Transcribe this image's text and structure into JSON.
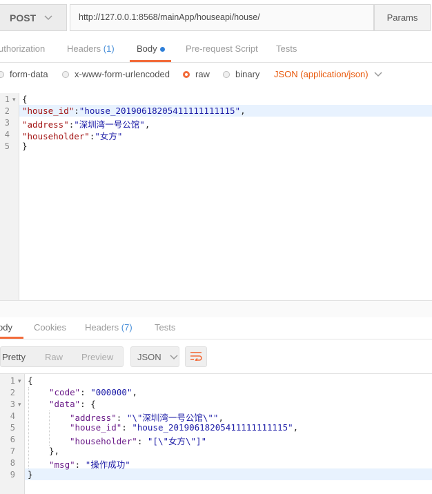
{
  "request": {
    "method": "POST",
    "url": "http://127.0.0.1:8568/mainApp/houseapi/house/",
    "params_label": "Params"
  },
  "request_tabs": [
    {
      "label": "uthorization"
    },
    {
      "label": "Headers",
      "count": "(1)"
    },
    {
      "label": "Body"
    },
    {
      "label": "Pre-request Script"
    },
    {
      "label": "Tests"
    }
  ],
  "body_options": {
    "form_data": "form-data",
    "urlencoded": "x-www-form-urlencoded",
    "raw": "raw",
    "binary": "binary",
    "content_type": "JSON (application/json)"
  },
  "request_body": {
    "line_numbers": [
      "1",
      "2",
      "3",
      "4",
      "5"
    ],
    "l1": "{",
    "l2_key": "\"house_id\"",
    "l2_colon": ":",
    "l2_val": "\"house_20190618205411111111115\"",
    "l2_comma": ",",
    "l3_key": "\"address\"",
    "l3_colon": ":",
    "l3_val": "\"深圳湾一号公馆\"",
    "l3_comma": ",",
    "l4_key": "\"householder\"",
    "l4_colon": ":",
    "l4_val": "\"女方\"",
    "l5": "}"
  },
  "response_tabs": [
    {
      "label": "ody"
    },
    {
      "label": "Cookies"
    },
    {
      "label": "Headers",
      "count": "(7)"
    },
    {
      "label": "Tests"
    }
  ],
  "response_view": {
    "pretty": "Pretty",
    "raw": "Raw",
    "preview": "Preview",
    "format": "JSON"
  },
  "response_body": {
    "line_numbers": [
      "1",
      "2",
      "3",
      "4",
      "5",
      "6",
      "7",
      "8",
      "9"
    ],
    "l1": "{",
    "l2_key": "\"code\"",
    "l2_rest": ": ",
    "l2_val": "\"000000\"",
    "l2_end": ",",
    "l3_key": "\"data\"",
    "l3_rest": ": {",
    "l4_key": "\"address\"",
    "l4_rest": ": ",
    "l4_val": "\"\\\"深圳湾一号公馆\\\"\"",
    "l4_end": ",",
    "l5_key": "\"house_id\"",
    "l5_rest": ": ",
    "l5_val": "\"house_20190618205411111111115\"",
    "l5_end": ",",
    "l6_key": "\"householder\"",
    "l6_rest": ": ",
    "l6_val": "\"[\\\"女方\\\"]\"",
    "l7": "},",
    "l8_key": "\"msg\"",
    "l8_rest": ": ",
    "l8_val": "\"操作成功\"",
    "l9": "}"
  },
  "colors": {
    "accent": "#f26b3a",
    "count_blue": "#4a90d9",
    "content_type": "#e8590c"
  }
}
